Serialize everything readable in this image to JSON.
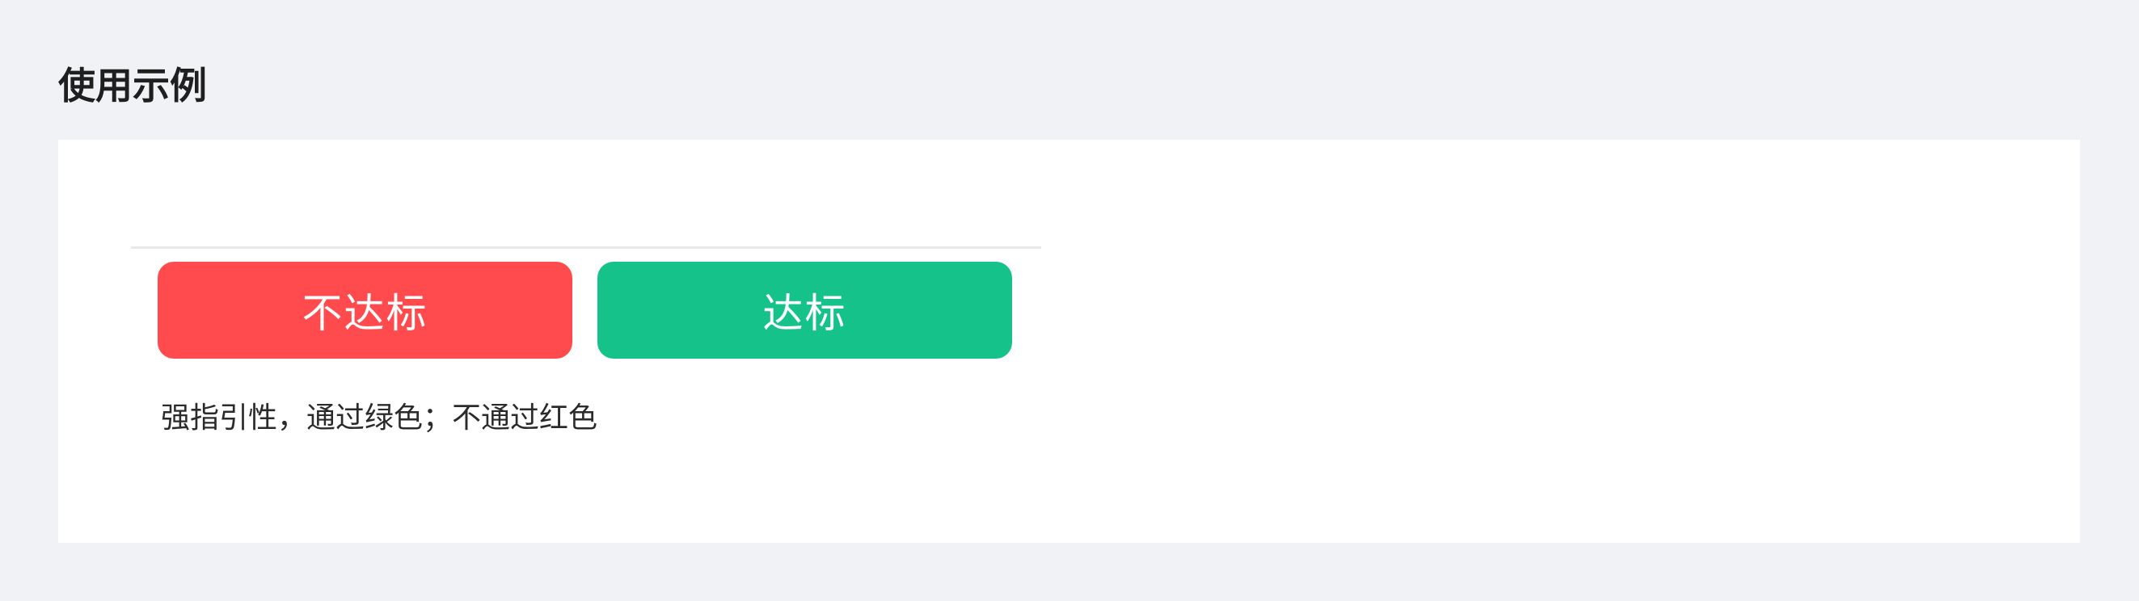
{
  "section": {
    "title": "使用示例"
  },
  "example": {
    "fail_button_label": "不达标",
    "pass_button_label": "达标",
    "description": "强指引性，通过绿色；不通过红色"
  },
  "colors": {
    "fail": "#ff4a4e",
    "pass": "#15c28a",
    "page_background": "#f1f2f6",
    "card_background": "#ffffff"
  }
}
